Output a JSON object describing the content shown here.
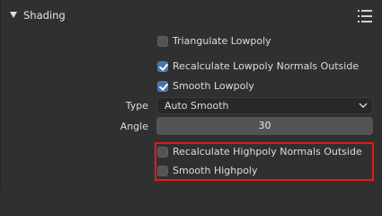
{
  "panel": {
    "title": "Shading"
  },
  "options": {
    "triangulate_lowpoly": {
      "label": "Triangulate Lowpoly",
      "checked": false
    },
    "recalc_lowpoly_normals": {
      "label": "Recalculate Lowpoly Normals Outside",
      "checked": true
    },
    "smooth_lowpoly": {
      "label": "Smooth Lowpoly",
      "checked": true
    },
    "recalc_highpoly_normals": {
      "label": "Recalculate Highpoly Normals Outside",
      "checked": false
    },
    "smooth_highpoly": {
      "label": "Smooth Highpoly",
      "checked": false
    }
  },
  "type_field": {
    "label": "Type",
    "value": "Auto Smooth"
  },
  "angle_field": {
    "label": "Angle",
    "value": "30"
  },
  "colors": {
    "background": "#303030",
    "checkbox_on": "#4772b3",
    "checkbox_off": "#545454",
    "highlight": "#e5191c"
  },
  "icons": {
    "collapse": "chevron-down-icon",
    "drag": "drag-handle-icon",
    "dropdown": "chevron-down-icon"
  }
}
